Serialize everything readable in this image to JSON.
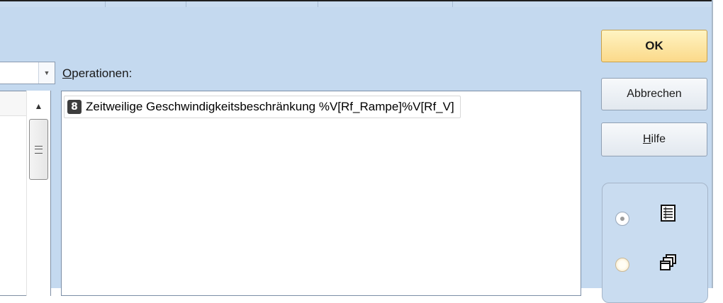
{
  "dialog": {
    "operations_label_accel": "O",
    "operations_label_rest": "perationen:",
    "operations": [
      {
        "icon": "8",
        "text": "Zeitweilige Geschwindigkeitsbeschränkung %V[Rf_Rampe]%V[Rf_V]"
      }
    ]
  },
  "buttons": {
    "ok": "OK",
    "cancel": "Abbrechen",
    "help_accel": "H",
    "help_rest": "ilfe"
  },
  "view_options": [
    {
      "icon": "list-view-icon",
      "selected": true
    },
    {
      "icon": "cascade-windows-icon",
      "selected": false
    }
  ],
  "colors": {
    "window_bg": "#c4d9ef",
    "ok_button": "#fbd98a"
  }
}
